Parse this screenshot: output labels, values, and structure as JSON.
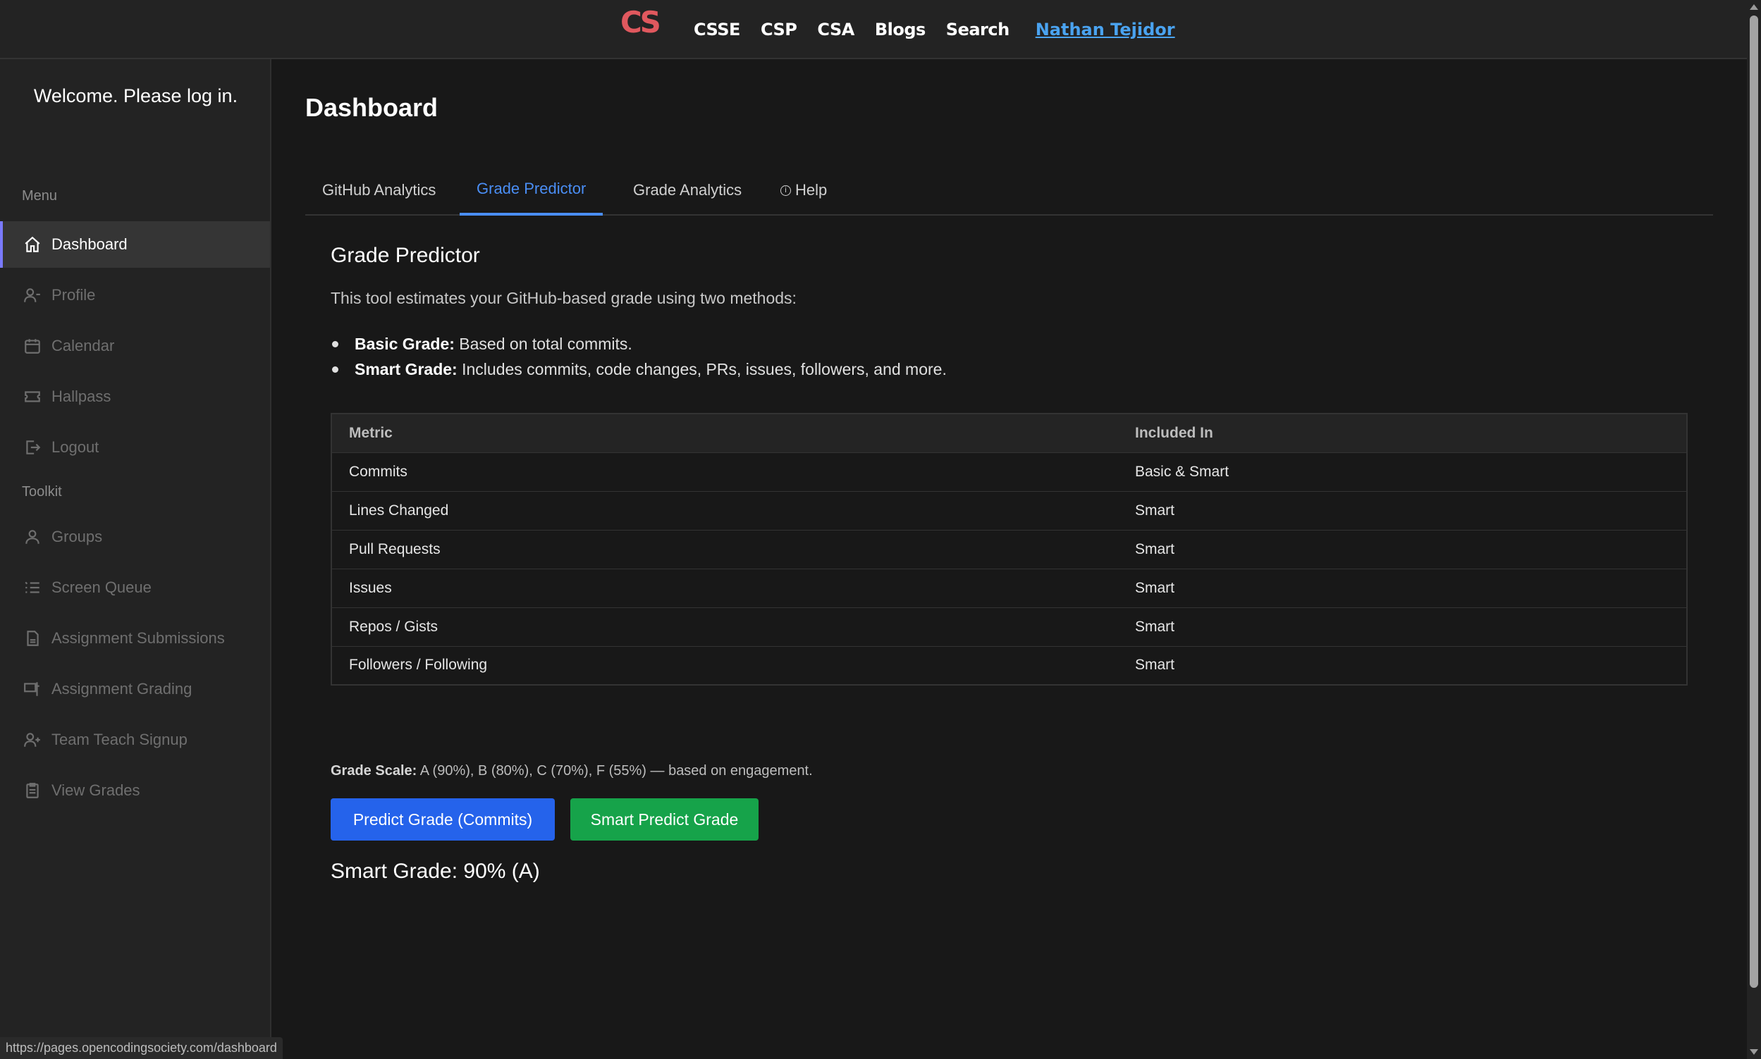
{
  "navbar": {
    "logo_text": "CS",
    "links": [
      "CSSE",
      "CSP",
      "CSA",
      "Blogs",
      "Search"
    ],
    "user": "Nathan Tejidor"
  },
  "sidebar": {
    "welcome": "Welcome. Please log in.",
    "menu_label": "Menu",
    "toolkit_label": "Toolkit",
    "menu_items": [
      {
        "label": "Dashboard",
        "icon": "home-icon",
        "active": true
      },
      {
        "label": "Profile",
        "icon": "profile-icon"
      },
      {
        "label": "Calendar",
        "icon": "calendar-icon"
      },
      {
        "label": "Hallpass",
        "icon": "ticket-icon"
      },
      {
        "label": "Logout",
        "icon": "logout-icon"
      }
    ],
    "toolkit_items": [
      {
        "label": "Groups",
        "icon": "users-icon"
      },
      {
        "label": "Screen Queue",
        "icon": "list-icon"
      },
      {
        "label": "Assignment Submissions",
        "icon": "document-icon"
      },
      {
        "label": "Assignment Grading",
        "icon": "grading-icon"
      },
      {
        "label": "Team Teach Signup",
        "icon": "user-plus-icon"
      },
      {
        "label": "View Grades",
        "icon": "clipboard-icon"
      }
    ]
  },
  "main": {
    "title": "Dashboard",
    "tabs": [
      {
        "label": "GitHub Analytics"
      },
      {
        "label": "Grade Predictor",
        "active": true
      },
      {
        "label": "Grade Analytics"
      },
      {
        "label": "Help",
        "icon": "info-icon"
      }
    ],
    "section_title": "Grade Predictor",
    "intro": "This tool estimates your GitHub-based grade using two methods:",
    "bullets": [
      {
        "term": "Basic Grade:",
        "text": "Based on total commits."
      },
      {
        "term": "Smart Grade:",
        "text": "Includes commits, code changes, PRs, issues, followers, and more."
      }
    ],
    "table": {
      "headers": [
        "Metric",
        "Included In"
      ],
      "rows": [
        [
          "Commits",
          "Basic & Smart"
        ],
        [
          "Lines Changed",
          "Smart"
        ],
        [
          "Pull Requests",
          "Smart"
        ],
        [
          "Issues",
          "Smart"
        ],
        [
          "Repos / Gists",
          "Smart"
        ],
        [
          "Followers / Following",
          "Smart"
        ]
      ]
    },
    "scale_label": "Grade Scale:",
    "scale_text": "A (90%), B (80%), C (70%), F (55%) — based on engagement.",
    "buttons": {
      "predict": "Predict Grade (Commits)",
      "smart_predict": "Smart Predict Grade"
    },
    "result": "Smart Grade: 90% (A)"
  },
  "status_url": "https://pages.opencodingsociety.com/dashboard",
  "colors": {
    "accent_blue": "#2563eb",
    "accent_green": "#16a34a",
    "tab_active": "#4a8ef5",
    "logo": "#e0585e",
    "user_link": "#4aa3f0"
  }
}
